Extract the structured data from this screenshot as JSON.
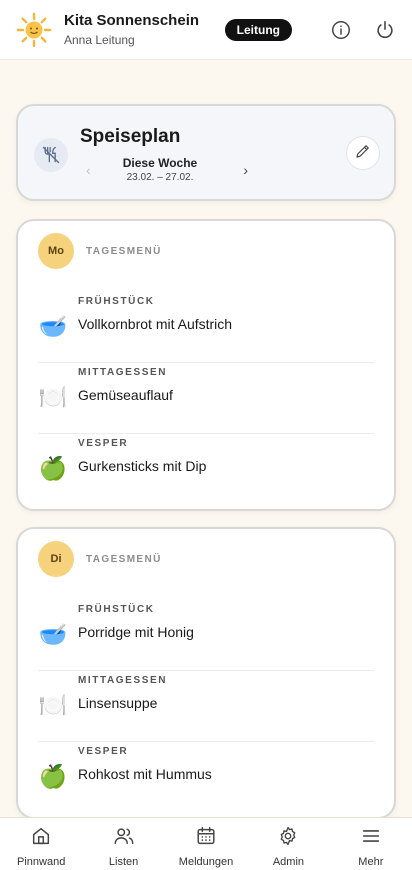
{
  "header": {
    "title": "Kita Sonnenschein",
    "subtitle": "Anna Leitung",
    "role_badge": "Leitung",
    "icons": [
      "sun-logo-icon",
      "info-icon",
      "power-icon"
    ]
  },
  "plan": {
    "title": "Speiseplan",
    "week_label": "Diese Woche",
    "week_range": "23.02. – 27.02.",
    "prev": "‹",
    "next": "›"
  },
  "days": [
    {
      "abbr": "Mo",
      "kicker": "TAGESMENÜ",
      "meals": [
        {
          "emoji": "🥣",
          "category": "FRÜHSTÜCK",
          "name": "Vollkornbrot mit Aufstrich"
        },
        {
          "emoji": "🍽️",
          "category": "MITTAGESSEN",
          "name": "Gemüseauflauf"
        },
        {
          "emoji": "🍏",
          "category": "VESPER",
          "name": "Gurkensticks mit Dip"
        }
      ]
    },
    {
      "abbr": "Di",
      "kicker": "TAGESMENÜ",
      "meals": [
        {
          "emoji": "🥣",
          "category": "FRÜHSTÜCK",
          "name": "Porridge mit Honig"
        },
        {
          "emoji": "🍽️",
          "category": "MITTAGESSEN",
          "name": "Linsensuppe"
        },
        {
          "emoji": "🍏",
          "category": "VESPER",
          "name": "Rohkost mit Hummus"
        }
      ]
    }
  ],
  "nav": [
    {
      "label": "Pinnwand",
      "icon": "home-icon"
    },
    {
      "label": "Listen",
      "icon": "users-icon"
    },
    {
      "label": "Meldungen",
      "icon": "calendar-icon"
    },
    {
      "label": "Admin",
      "icon": "gear-icon"
    },
    {
      "label": "Mehr",
      "icon": "menu-icon"
    }
  ],
  "colors": {
    "page_bg": "#fdf8ef",
    "day_badge": "#f6d27d",
    "role_badge_bg": "#111111"
  }
}
